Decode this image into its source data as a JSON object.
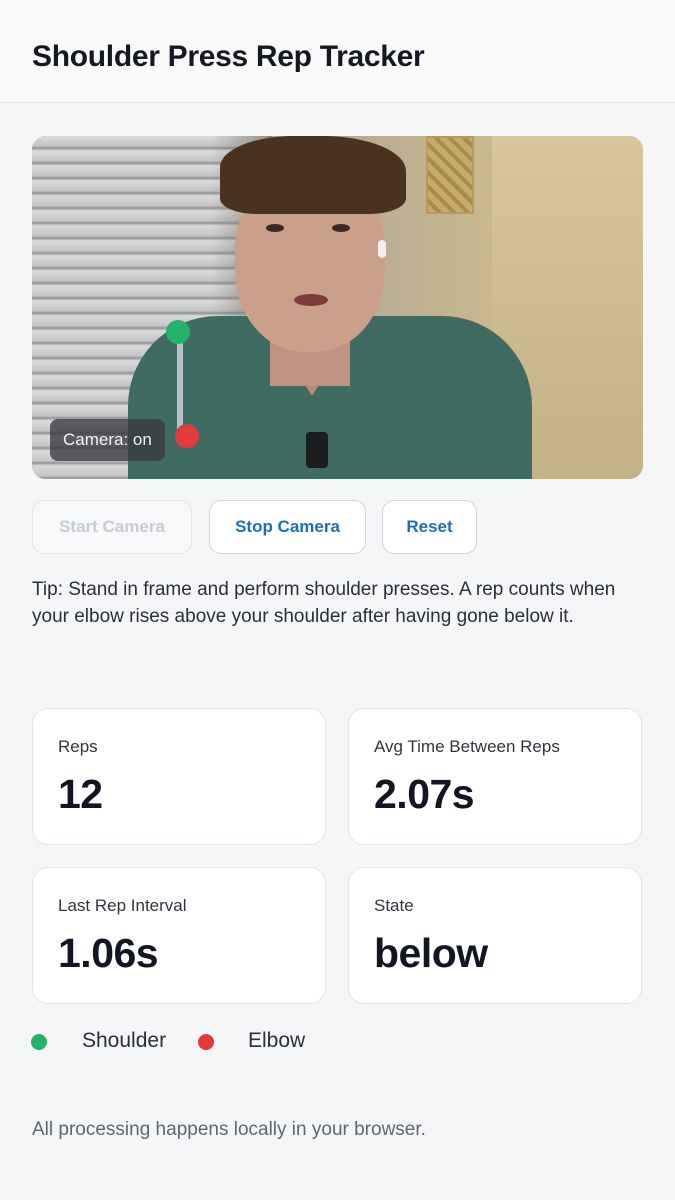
{
  "header": {
    "title": "Shoulder Press Rep Tracker"
  },
  "video": {
    "camera_status": "Camera: on",
    "overlay_colors": {
      "shoulder": "#22b369",
      "elbow": "#e23b3b"
    }
  },
  "controls": {
    "start_label": "Start Camera",
    "start_enabled": false,
    "stop_label": "Stop Camera",
    "reset_label": "Reset"
  },
  "tip": "Tip: Stand in frame and perform shoulder presses. A rep counts when your elbow rises above your shoulder after having gone below it.",
  "stats": {
    "reps": {
      "label": "Reps",
      "value": "12"
    },
    "avg": {
      "label": "Avg Time Between Reps",
      "value": "2.07s"
    },
    "last": {
      "label": "Last Rep Interval",
      "value": "1.06s"
    },
    "state": {
      "label": "State",
      "value": "below"
    }
  },
  "legend": {
    "shoulder": "Shoulder",
    "elbow": "Elbow"
  },
  "footer": "All processing happens locally in your browser.",
  "colors": {
    "accent": "#1b6fbf",
    "shoulder": "#22b369",
    "elbow": "#e23b3b"
  }
}
